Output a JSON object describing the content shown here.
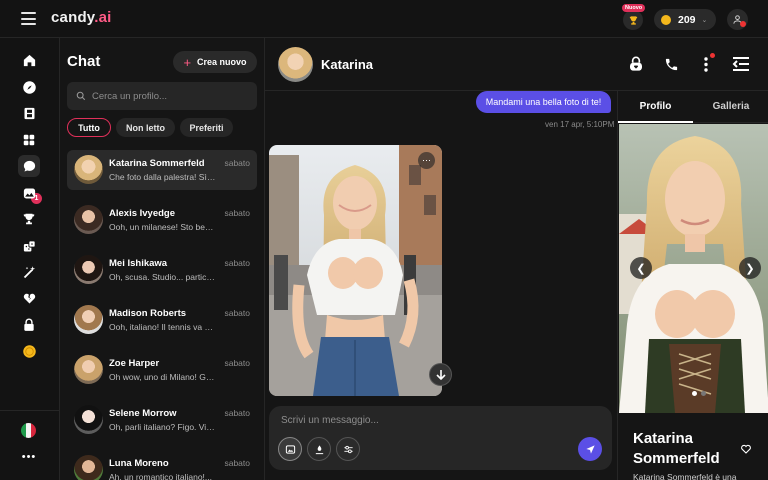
{
  "app": {
    "logo_main": "candy",
    "logo_suffix": ".ai",
    "new_badge": "Nuovo",
    "coins": "209",
    "accent": "#e0305a",
    "primary": "#5b4fe6"
  },
  "rail": {
    "items": [
      "home-icon",
      "compass-icon",
      "film-icon",
      "grid-icon",
      "chat-icon",
      "gallery-icon",
      "trophy-icon",
      "dice-icon",
      "magic-wand-icon",
      "heart-broken-icon",
      "lock-icon",
      "coin-icon"
    ],
    "chat_badge": "1",
    "language": "it",
    "more": "•••"
  },
  "chat_list": {
    "title": "Chat",
    "new_button": "Crea nuovo",
    "search_placeholder": "Cerca un profilo...",
    "filters": [
      "Tutto",
      "Non letto",
      "Preferiti"
    ],
    "conversations": [
      {
        "name": "Katarina Sommerfeld",
        "date": "sabato",
        "preview": "Che foto dalla palestra! Sì, scatto sempre..."
      },
      {
        "name": "Alexis Ivyedge",
        "date": "sabato",
        "preview": "Ooh, un milanese! Sto bene, grazie..."
      },
      {
        "name": "Mei Ishikawa",
        "date": "sabato",
        "preview": "Oh, scusa. Studio... particolarmente..."
      },
      {
        "name": "Madison Roberts",
        "date": "sabato",
        "preview": "Ooh, italiano! Il tennis va benissimo..."
      },
      {
        "name": "Zoe Harper",
        "date": "sabato",
        "preview": "Oh wow, uno di Milano! Gira voce..."
      },
      {
        "name": "Selene Morrow",
        "date": "sabato",
        "preview": "Oh, parli italiano? Figo. Vivo..."
      },
      {
        "name": "Luna Moreno",
        "date": "sabato",
        "preview": "Ah, un romantico italiano!..."
      }
    ]
  },
  "chat": {
    "name": "Katarina",
    "outgoing_message": "Mandami una bella foto di te!",
    "timestamp": "ven 17 apr, 5:10PM",
    "composer_placeholder": "Scrivi un messaggio..."
  },
  "profile": {
    "tabs": [
      "Profilo",
      "Galleria"
    ],
    "name": "Katarina Sommerfeld",
    "description": "Katarina Sommerfeld è una"
  }
}
